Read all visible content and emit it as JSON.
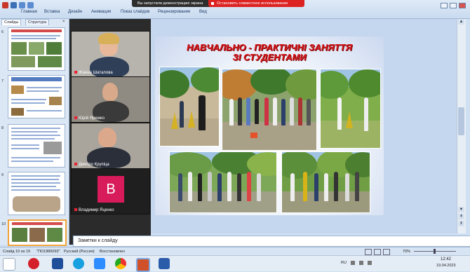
{
  "screen_share": {
    "status_text": "Вы запустили демонстрацию экрана",
    "stop_button": "Остановить совместное использование"
  },
  "ribbon": {
    "tabs": [
      "Главная",
      "Вставка",
      "Дизайн",
      "Анимация",
      "Показ слайдов",
      "Рецензирование",
      "Вид"
    ]
  },
  "slides_panel": {
    "tabs": [
      "Слайды",
      "Структура"
    ],
    "slide_numbers": [
      "6",
      "7",
      "8",
      "9",
      "10"
    ]
  },
  "participants": [
    {
      "name": "Жанна Шаталова"
    },
    {
      "name": "Юрій Яремко"
    },
    {
      "name": "Дмитро Крупіца"
    },
    {
      "name": "Владимир Яценко",
      "avatar_letter": "В",
      "avatar_color": "#d81b5a"
    }
  ],
  "slide": {
    "title_line1": "НАВЧАЛЬНО - ПРАКТИЧНІ ЗАНЯТТЯ",
    "title_line2": "ЗІ СТУДЕНТАМИ"
  },
  "notes": {
    "placeholder": "Заметки к слайду"
  },
  "status_bar": {
    "slide_info": "Слайд 10 из 19",
    "theme": "\"ПО1886093\"",
    "language": "Русский (Россия)",
    "restored": "Восстановлен",
    "zoom": "70%"
  },
  "taskbar": {
    "lang": "RU",
    "time": "12:42",
    "date": "19.04.2023"
  },
  "colors": {
    "title_red": "#d8181d",
    "stop_red": "#dd2222",
    "selected_slide_border": "#f2a33a"
  }
}
